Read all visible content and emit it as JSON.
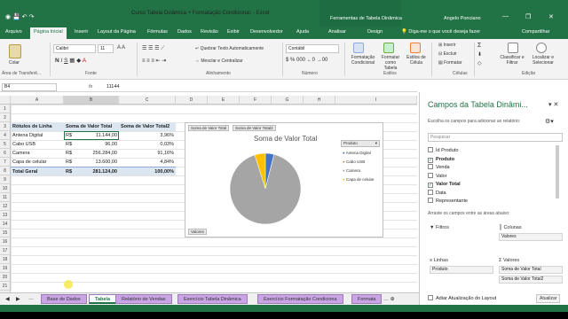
{
  "window": {
    "title": "Curso Tabela Dinâmica + Formatação Condicional.  -  Excel",
    "context_tab": "Ferramentas de Tabela Dinâmica",
    "user": "Angelo Ponciano",
    "controls": [
      "—",
      "❐",
      "✕"
    ]
  },
  "tabs": [
    "Arquivo",
    "Página Inicial",
    "Inserir",
    "Layout da Página",
    "Fórmulas",
    "Dados",
    "Revisão",
    "Exibir",
    "Desenvolvedor",
    "Ajuda",
    "Analisar",
    "Design"
  ],
  "tell_me": "Diga-me o que você deseja fazer",
  "share": "Compartilhar",
  "ribbon": {
    "paste": "Colar",
    "font_name": "Calibri",
    "font_size": "11",
    "wrap_text": "Quebrar Texto Automaticamente",
    "merge_center": "Mesclar e Centralizar",
    "number_format": "Contábil",
    "cond_format": "Formatação Condicional",
    "format_table": "Formatar como Tabela",
    "cell_styles": "Estilos de Célula",
    "insert": "Inserir",
    "delete": "Excluir",
    "format": "Formatar",
    "sort_filter": "Classificar e Filtrar",
    "find_select": "Localizar e Selecionar",
    "groups": {
      "clipboard": "Área de Transferê...",
      "font": "Fonte",
      "alignment": "Alinhamento",
      "number": "Número",
      "styles": "Estilos",
      "cells": "Células",
      "editing": "Edição"
    }
  },
  "formula_bar": {
    "name_box": "B4",
    "fx": "fx",
    "value": "11144"
  },
  "columns": [
    "A",
    "B",
    "C",
    "D",
    "E",
    "F",
    "G",
    "H",
    "I"
  ],
  "rows": [
    "1",
    "2",
    "3",
    "4",
    "5",
    "6",
    "7",
    "8",
    "9",
    "10",
    "11",
    "12",
    "13",
    "14",
    "15",
    "16",
    "17",
    "18",
    "19",
    "20",
    "21",
    "22"
  ],
  "pivot": {
    "headers": [
      "Rótulos de Linha",
      "Soma de Valor Total",
      "Soma de Valor Total2"
    ],
    "rows": [
      {
        "label": "Antena Digital",
        "cur": "R$",
        "v1": "11.144,00",
        "v2": "3,96%"
      },
      {
        "label": "Cabo USB",
        "cur": "R$",
        "v1": "96,00",
        "v2": "0,03%"
      },
      {
        "label": "Camera",
        "cur": "R$",
        "v1": "256.284,00",
        "v2": "91,16%"
      },
      {
        "label": "Capa de celular",
        "cur": "R$",
        "v1": "13.600,00",
        "v2": "4,84%"
      }
    ],
    "total": {
      "label": "Total Geral",
      "cur": "R$",
      "v1": "281.124,00",
      "v2": "100,00%"
    }
  },
  "chart": {
    "buttons": [
      "Soma de Valor Total",
      "Soma de Valor Total2"
    ],
    "title": "Soma de Valor Total",
    "legend_title": "Produto",
    "values_button": "Valores",
    "legend": [
      "Antena Digital",
      "Cabo USB",
      "Camera",
      "Capa de celular"
    ],
    "colors": [
      "#4472c4",
      "#ed7d31",
      "#a5a5a5",
      "#ffc000"
    ]
  },
  "chart_data": {
    "type": "pie",
    "title": "Soma de Valor Total",
    "categories": [
      "Antena Digital",
      "Cabo USB",
      "Camera",
      "Capa de celular"
    ],
    "values": [
      11144,
      96,
      256284,
      13600
    ]
  },
  "sheets": [
    "Base de Dados",
    "Tabela",
    "Relatório de Vendas",
    "Exercício Tabela Dinâmica",
    "Exercício Formatação Condiciona",
    "Formata"
  ],
  "pane": {
    "title": "Campos da Tabela Dinâmi...",
    "subtitle": "Escolha os campos para adicionar ao relatório:",
    "search_placeholder": "Pesquisar",
    "fields": [
      {
        "name": "Id Produto",
        "checked": false
      },
      {
        "name": "Produto",
        "checked": true
      },
      {
        "name": "Venda",
        "checked": false
      },
      {
        "name": "Valor",
        "checked": false
      },
      {
        "name": "Valor Total",
        "checked": true
      },
      {
        "name": "Data",
        "checked": false
      },
      {
        "name": "Representante",
        "checked": false
      }
    ],
    "drag_hint": "Arraste os campos entre as áreas abaixo:",
    "filters_label": "Filtros",
    "columns_label": "Colunas",
    "columns_item": "Valores",
    "rows_label": "Linhas",
    "rows_item": "Produto",
    "values_label": "Valores",
    "values_items": [
      "Soma de Valor Total",
      "Soma de Valor Total2"
    ],
    "defer": "Adiar Atualização do Layout",
    "update": "Atualizar"
  }
}
